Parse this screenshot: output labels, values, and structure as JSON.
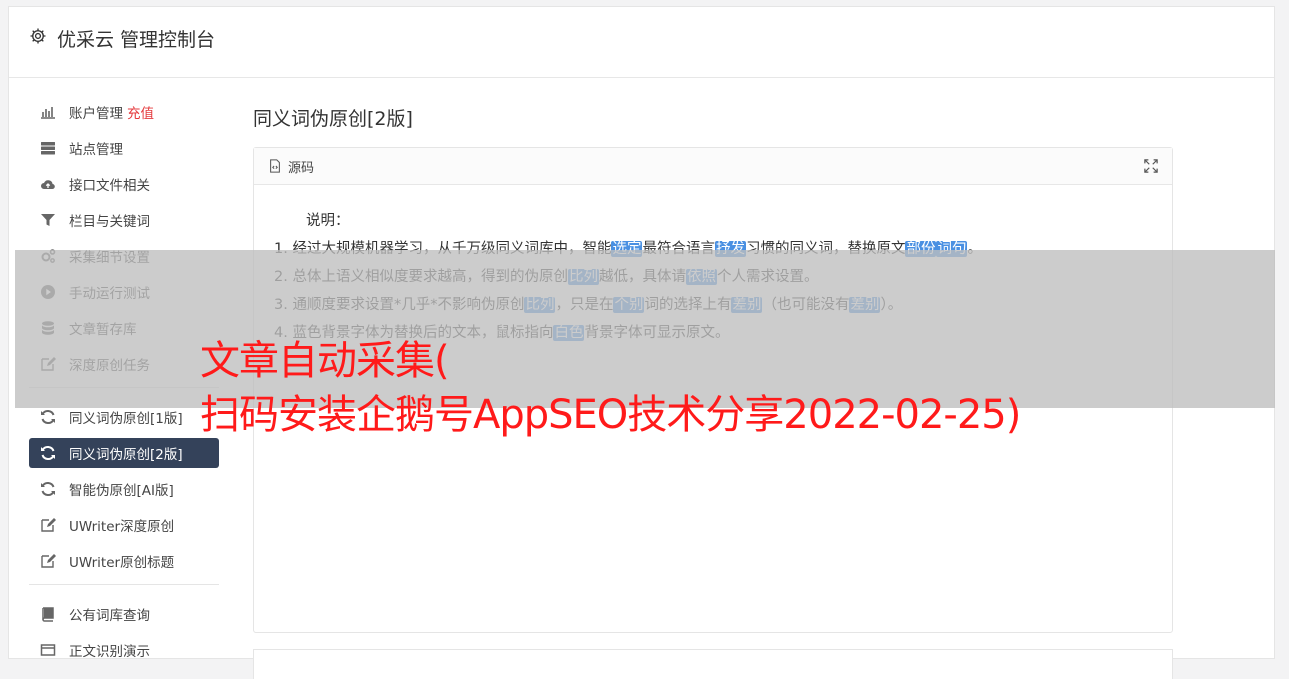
{
  "header": {
    "title": "优采云 管理控制台"
  },
  "sidebar": {
    "items": [
      {
        "label": "账户管理",
        "extra": "充值",
        "icon": "bar-chart-icon"
      },
      {
        "label": "站点管理",
        "icon": "server-icon"
      },
      {
        "label": "接口文件相关",
        "icon": "cloud-upload-icon"
      },
      {
        "label": "栏目与关键词",
        "icon": "filter-icon"
      },
      {
        "label": "采集细节设置",
        "icon": "cogs-icon"
      },
      {
        "label": "手动运行测试",
        "icon": "play-circle-icon"
      },
      {
        "label": "文章暂存库",
        "icon": "database-icon"
      },
      {
        "label": "深度原创任务",
        "icon": "edit-icon"
      },
      {
        "label": "同义词伪原创[1版]",
        "icon": "refresh-icon"
      },
      {
        "label": "同义词伪原创[2版]",
        "icon": "refresh-icon",
        "active": true
      },
      {
        "label": "智能伪原创[AI版]",
        "icon": "refresh-icon"
      },
      {
        "label": "UWriter深度原创",
        "icon": "edit-icon"
      },
      {
        "label": "UWriter原创标题",
        "icon": "edit-icon"
      },
      {
        "label": "公有词库查询",
        "icon": "book-icon"
      },
      {
        "label": "正文识别演示",
        "icon": "window-icon"
      }
    ]
  },
  "main": {
    "title": "同义词伪原创[2版]",
    "panel": {
      "header": "源码",
      "intro": "说明：",
      "lines": [
        [
          "1. 经过大规模机器学习，从千万级同义词库中，智能",
          {
            "hl": "选定"
          },
          "最符合语言",
          {
            "hl": "抒发"
          },
          "习惯的同义词，替换原文",
          {
            "hl": "部份"
          },
          {
            "hl": "词句"
          },
          "。"
        ],
        [
          "2. 总体上语义相似度要求越高，得到的伪原创",
          {
            "hl": "比列"
          },
          "越低，具体请",
          {
            "hl": "依照"
          },
          "个人需求设置。"
        ],
        [
          "3. 通顺度要求设置*几乎*不影响伪原创",
          {
            "hl": "比列"
          },
          "，只是在",
          {
            "hl": "个别"
          },
          "词的选择上有",
          {
            "hl": "差别"
          },
          "（也可能没有",
          {
            "hl": "差别"
          },
          "）。"
        ],
        [
          "4. 蓝色背景字体为替换后的文本，鼠标指向",
          {
            "hl": "白色"
          },
          "背景字体可显示原文。"
        ]
      ]
    }
  },
  "overlay": {
    "line1": "文章自动采集(",
    "line2": "扫码安装企鹅号AppSEO技术分享2022-02-25)"
  },
  "colors": {
    "active_bg": "#34425a",
    "highlight": "#4a90e2",
    "overlay_text": "#ff1a1a",
    "recharge": "#e4393c"
  }
}
